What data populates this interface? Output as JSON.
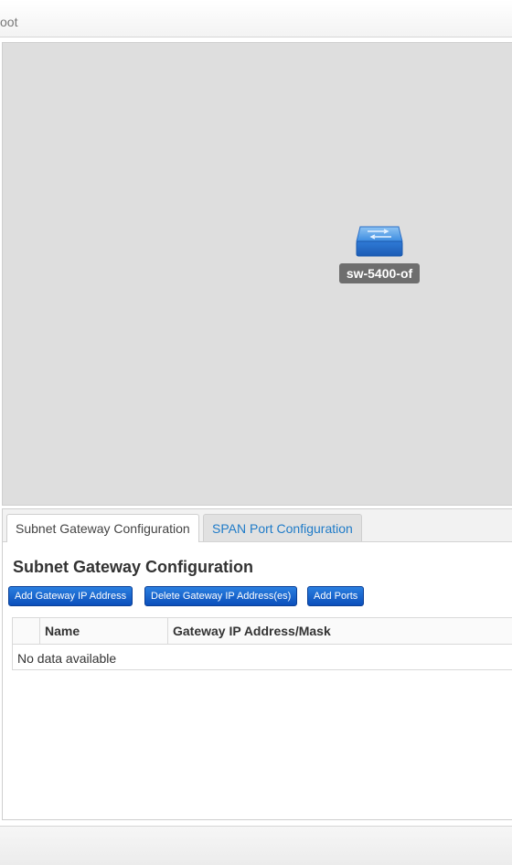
{
  "header": {
    "breadcrumb": "oot"
  },
  "topology": {
    "nodes": [
      {
        "label": "sw-5400-of",
        "icon": "network-switch-icon"
      }
    ]
  },
  "tabs": [
    {
      "label": "Subnet Gateway Configuration",
      "active": true
    },
    {
      "label": "SPAN Port Configuration",
      "active": false
    }
  ],
  "section": {
    "title": "Subnet Gateway Configuration",
    "buttons": {
      "add_gateway": "Add Gateway IP Address",
      "delete_gateway": "Delete Gateway IP Address(es)",
      "add_ports": "Add Ports"
    },
    "table": {
      "columns": [
        "",
        "Name",
        "Gateway IP Address/Mask"
      ],
      "empty_text": "No data available",
      "rows": []
    }
  },
  "colors": {
    "accent_blue": "#1f7bc8",
    "button_blue": "#0b4fbb",
    "canvas_gray": "#dedede",
    "node_label_bg": "#6e6e6e"
  }
}
